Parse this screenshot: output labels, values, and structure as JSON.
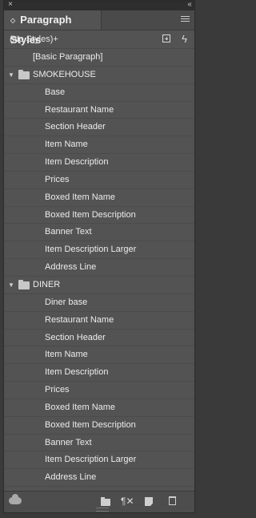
{
  "titlebar": {
    "close_icon": "×",
    "collapse_icon": "‹‹"
  },
  "panel": {
    "title": "Paragraph Styles"
  },
  "toolbar": {
    "current_style": "(No Styles)+"
  },
  "list": {
    "basic": "[Basic Paragraph]",
    "groups": [
      {
        "name": "SMOKEHOUSE",
        "items": [
          "Base",
          "Restaurant Name",
          "Section Header",
          "Item Name",
          "Item Description",
          "Prices",
          "Boxed Item Name",
          "Boxed Item Description",
          "Banner Text",
          "Item Description Larger",
          "Address Line"
        ]
      },
      {
        "name": "DINER",
        "items": [
          "Diner base",
          "Restaurant Name",
          "Section Header",
          "Item Name",
          "Item Description",
          "Prices",
          "Boxed Item Name",
          "Boxed Item Description",
          "Banner Text",
          "Item Description Larger",
          "Address Line"
        ]
      }
    ]
  },
  "icons": {
    "panel_menu": "hamburger-menu-icon",
    "new_style_group": "new-style-icon",
    "quick_apply": "lightning-icon",
    "bottom": [
      "cc-libraries-icon",
      "folder-icon",
      "clear-overrides-icon",
      "new-style-icon",
      "trash-icon"
    ]
  }
}
